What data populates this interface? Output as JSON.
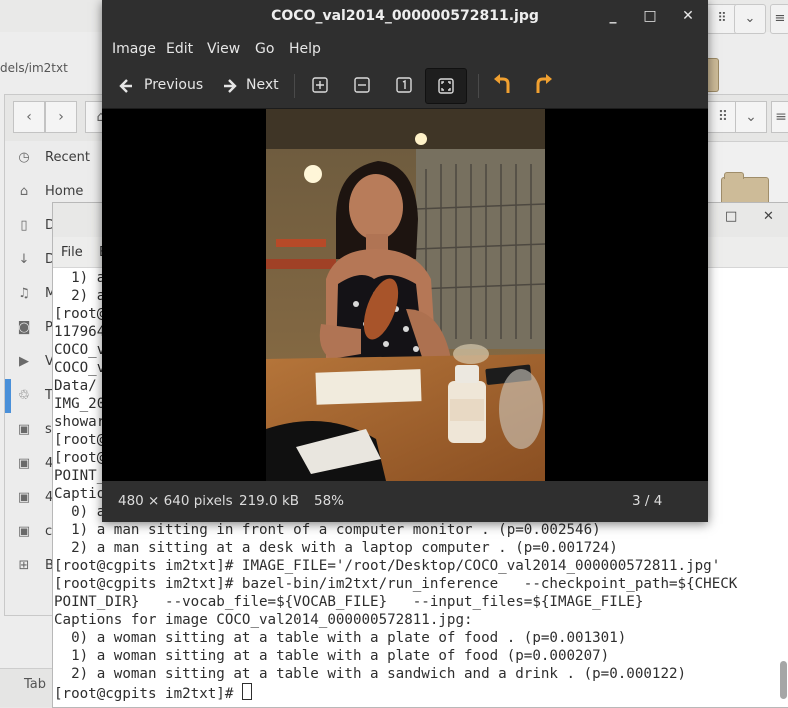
{
  "viewer": {
    "title": "COCO_val2014_000000572811.jpg",
    "menu": [
      "Image",
      "Edit",
      "View",
      "Go",
      "Help"
    ],
    "toolbar": {
      "previous": "Previous",
      "next": "Next"
    },
    "status": {
      "dimensions": "480 × 640 pixels",
      "filesize": "219.0 kB",
      "zoom": "58%",
      "position": "3 / 4"
    },
    "controls": {
      "minimize": "_",
      "maximize": "□",
      "close": "✕"
    }
  },
  "file_manager": {
    "path_fragment": "dels/im2txt",
    "sidebar": [
      {
        "icon": "recent-icon",
        "label": "Recent"
      },
      {
        "icon": "home-icon",
        "label": "Home"
      },
      {
        "icon": "document-icon",
        "label": "D"
      },
      {
        "icon": "download-icon",
        "label": "D"
      },
      {
        "icon": "music-icon",
        "label": "M"
      },
      {
        "icon": "camera-icon",
        "label": "P"
      },
      {
        "icon": "video-icon",
        "label": "V"
      },
      {
        "icon": "trash-icon",
        "label": "T"
      },
      {
        "icon": "drive-icon",
        "label": "s"
      },
      {
        "icon": "drive-icon",
        "label": "4"
      },
      {
        "icon": "drive-icon",
        "label": "4"
      },
      {
        "icon": "drive-icon",
        "label": "c"
      },
      {
        "icon": "network-icon",
        "label": "B"
      }
    ],
    "status_tab": "Tab"
  },
  "terminal": {
    "menu": [
      "File",
      "E"
    ],
    "lines": [
      "  1) a",
      "  2) a                                                              0)",
      "[root@",
      "117964",
      "COCO_v",
      "COCO_v",
      "Data/",
      "IMG_20",
      "showar",
      "[root@",
      "[root@                                                              ${CHECK",
      "POINT_",
      "Captio",
      "  0) a",
      "  1) a man sitting in front of a computer monitor . (p=0.002546)",
      "  2) a man sitting at a desk with a laptop computer . (p=0.001724)",
      "[root@cgpits im2txt]# IMAGE_FILE='/root/Desktop/COCO_val2014_000000572811.jpg'",
      "[root@cgpits im2txt]# bazel-bin/im2txt/run_inference   --checkpoint_path=${CHECK",
      "POINT_DIR}   --vocab_file=${VOCAB_FILE}   --input_files=${IMAGE_FILE}",
      "Captions for image COCO_val2014_000000572811.jpg:",
      "  0) a woman sitting at a table with a plate of food . (p=0.001301)",
      "  1) a woman sitting at a table with a plate of food (p=0.000207)",
      "  2) a woman sitting at a table with a sandwich and a drink . (p=0.000122)",
      "[root@cgpits im2txt]# "
    ]
  }
}
